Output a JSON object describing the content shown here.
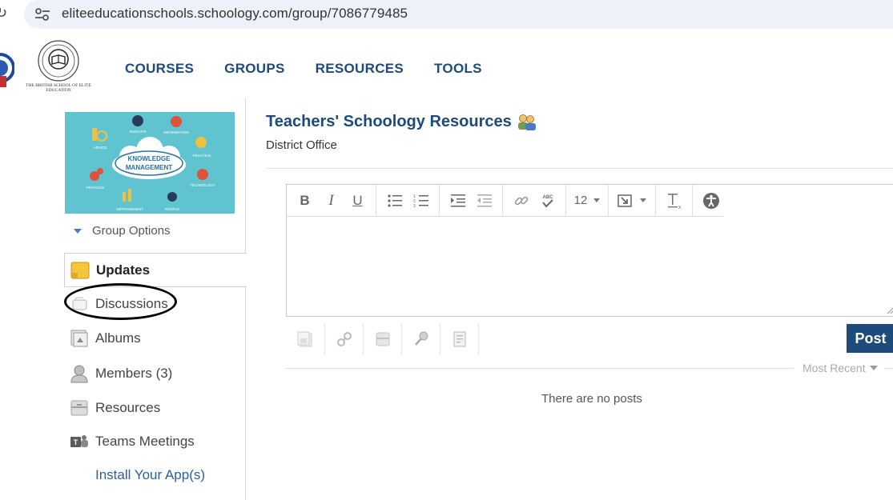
{
  "browser": {
    "url": "eliteeducationschools.schoology.com/group/7086779485"
  },
  "header": {
    "school_text": "THE BRITISH SCHOOL OF ELITE EDUCATION",
    "nav": [
      "COURSES",
      "GROUPS",
      "RESOURCES",
      "TOOLS"
    ]
  },
  "sidebar": {
    "group_options": "Group Options",
    "image_labels": {
      "center": "KNOWLEDGE MANAGEMENT",
      "advice": "ADVICE",
      "insights": "INSIGHTS",
      "information": "INFORMATION",
      "practice": "PRACTICE",
      "process": "PROCESS",
      "technology": "TECHNOLOGY",
      "improvement": "IMPROVEMENT",
      "people": "PEOPLE"
    },
    "items": [
      {
        "label": "Updates",
        "icon": "updates-icon"
      },
      {
        "label": "Discussions",
        "icon": "discussions-icon"
      },
      {
        "label": "Albums",
        "icon": "albums-icon"
      },
      {
        "label": "Members (3)",
        "icon": "members-icon"
      },
      {
        "label": "Resources",
        "icon": "resources-icon"
      },
      {
        "label": "Teams Meetings",
        "icon": "teams-icon"
      },
      {
        "label": "Install Your App(s)",
        "icon": ""
      }
    ]
  },
  "main": {
    "title": "Teachers' Schoology Resources",
    "subtitle": "District Office",
    "editor": {
      "toolbar": {
        "bold": "B",
        "italic": "I",
        "underline": "U",
        "font_size": "12",
        "spell": "ABC"
      }
    },
    "post_label": "Post",
    "sort_label": "Most Recent",
    "empty_text": "There are no posts"
  },
  "colors": {
    "brand": "#1e4a7a",
    "post_button": "#1f4b7c",
    "url_bar": "#eef1f8"
  }
}
